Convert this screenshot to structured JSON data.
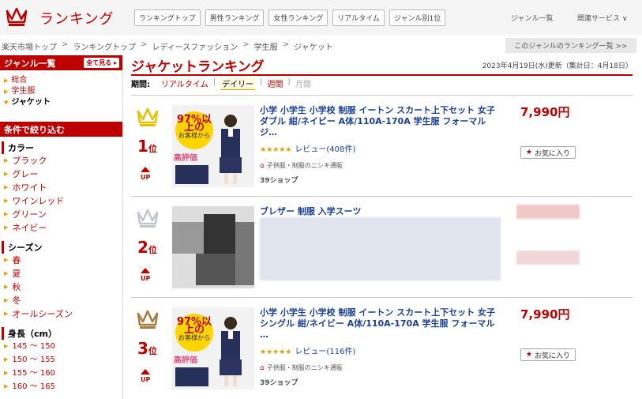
{
  "header": {
    "logo_label": "ランキング",
    "tabs": [
      "ランキングトップ",
      "男性ランキング",
      "女性ランキング",
      "リアルタイム",
      "ジャンル別1位"
    ],
    "genre_list": "ジャンル一覧",
    "related": "関連サービス ∨"
  },
  "breadcrumb": [
    "楽天市場トップ",
    "ランキングトップ",
    "レディースファッション",
    "学生服",
    "ジャケット"
  ],
  "genre_ranking_link": "このジャンルのランキング一覧 >>",
  "sidebar": {
    "genre_heading": "ジャンル一覧",
    "see_all": "全て見る",
    "genres": [
      {
        "label": "総合"
      },
      {
        "label": "学生服"
      },
      {
        "label": "ジャケット"
      }
    ],
    "filter_heading": "条件で絞り込む",
    "filters": [
      {
        "title": "カラー",
        "items": [
          "ブラック",
          "グレー",
          "ホワイト",
          "ワインレッド",
          "グリーン",
          "ネイビー"
        ]
      },
      {
        "title": "シーズン",
        "items": [
          "春",
          "夏",
          "秋",
          "冬",
          "オールシーズン"
        ]
      },
      {
        "title": "身長（cm）",
        "items": [
          "145 ～ 150",
          "150 ～ 155",
          "155 ～ 160",
          "160 ～ 165"
        ]
      }
    ]
  },
  "main": {
    "title": "ジャケットランキング",
    "updated": "2023年4月19日(水)更新（集計日：4月18日）",
    "period_label": "期間:",
    "periods": [
      "リアルタイム",
      "デイリー",
      "週間",
      "月間"
    ],
    "colors": {
      "accent": "#bf0000",
      "gold": "#e8c000",
      "silver": "#c0c4cc",
      "bronze": "#a57b3d",
      "link": "#1a3f96"
    },
    "items": [
      {
        "rank": "1",
        "rank_suffix": "位",
        "up": "UP",
        "title": "小学 小学生 小学校 制服 イートン スカート上下セット 女子 ダブル 紺/ネイビー A体/110A-170A 学生服 フォーマル ジ…",
        "stars": "★★★★★",
        "reviews": "レビュー(408件)",
        "shop": "子供服・制服のニシキ通販",
        "points": "39ショップ",
        "price": "7,990円",
        "fav": "お気に入り",
        "badge_top": "97%以上の",
        "badge_mid": "お客様から",
        "praise": "高評価"
      },
      {
        "rank": "2",
        "rank_suffix": "位",
        "up": "UP",
        "title": "ブレザー 制服 入学スーツ"
      },
      {
        "rank": "3",
        "rank_suffix": "位",
        "up": "UP",
        "title": "小学 小学生 小学校 制服 イートン スカート上下セット 女子 シングル 紺/ネイビー A体/110A-170A 学生服 フォーマル …",
        "stars": "★★★★★",
        "reviews": "レビュー(116件)",
        "shop": "子供服・制服のニシキ通販",
        "points": "39ショップ",
        "price": "7,990円",
        "fav": "お気に入り",
        "badge_top": "97%以上の",
        "badge_mid": "お客様から",
        "praise": "高評価"
      }
    ]
  }
}
